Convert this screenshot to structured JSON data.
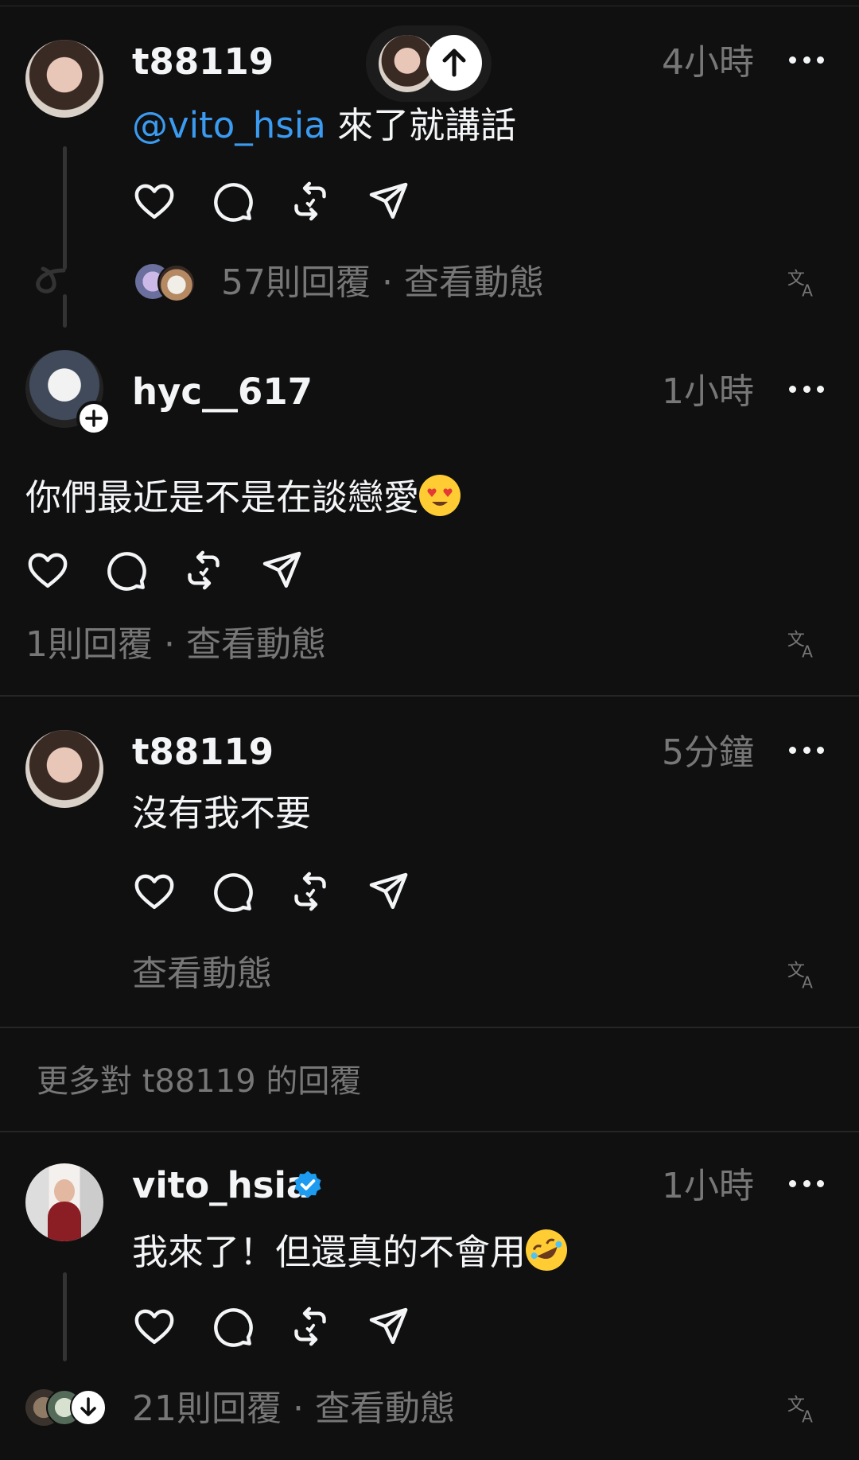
{
  "comments": [
    {
      "username": "t88119",
      "time": "4小時",
      "mention": "@vito_hsia",
      "text": " 來了就講話",
      "replies_meta": "57則回覆 · 查看動態"
    },
    {
      "username": "hyc__617",
      "time": "1小時",
      "text": "你們最近是不是在談戀愛",
      "emoji": "heart-eyes-emoji",
      "replies_meta": "1則回覆 · 查看動態"
    },
    {
      "username": "t88119",
      "time": "5分鐘",
      "text": "沒有我不要",
      "replies_meta": "查看動態"
    },
    {
      "username": "vito_hsia",
      "verified": true,
      "time": "1小時",
      "text": "我來了！但還真的不會用",
      "emoji": "rofl-emoji",
      "replies_meta": "21則回覆 · 查看動態"
    }
  ],
  "more_replies_label": "更多對 t88119 的回覆",
  "icons": [
    "heart-icon",
    "comment-icon",
    "repost-icon",
    "share-icon",
    "translate-icon",
    "more-icon",
    "arrow-up-icon",
    "plus-icon",
    "verified-icon",
    "arrow-down-icon"
  ],
  "colors": {
    "background": "#101010",
    "text": "#f3f5f7",
    "muted": "#777777",
    "mention": "#3b9bf1",
    "verified": "#1d9bf0"
  }
}
